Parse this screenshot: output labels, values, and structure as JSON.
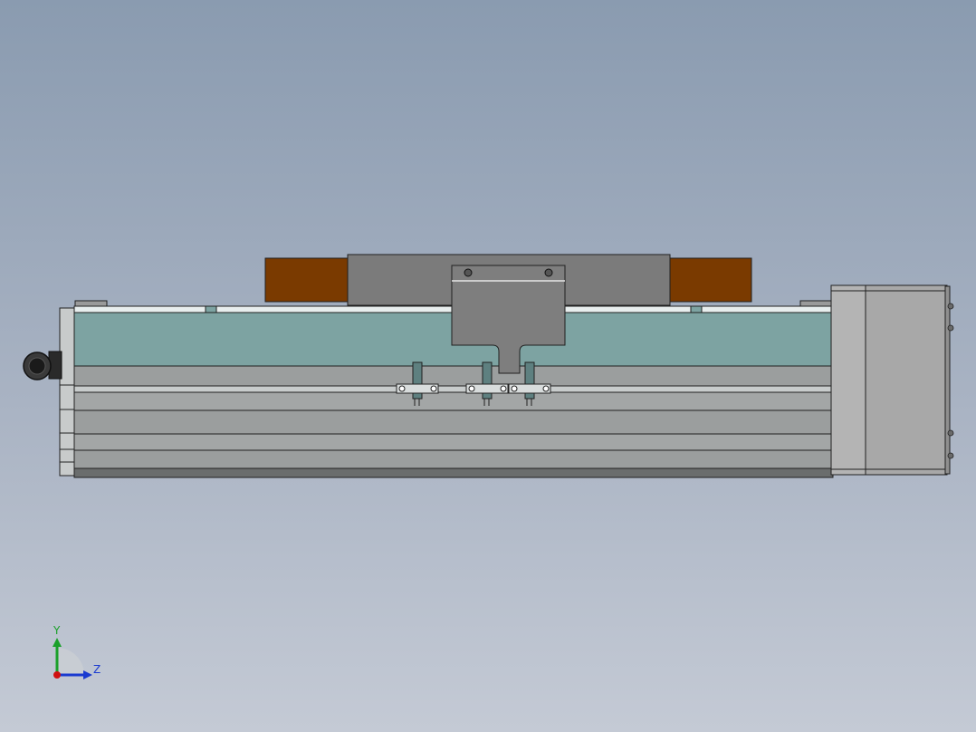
{
  "viewport": {
    "background_top": "#8a9bb0",
    "background_bottom": "#c4cad5"
  },
  "colors": {
    "rail_teal": "#7da3a2",
    "carriage_gray": "#7b7b7b",
    "bellows_brown": "#7a3a00",
    "motor_gray": "#a8a8a8",
    "outline": "#202020"
  },
  "triad": {
    "y_label": "Y",
    "z_label": "Z",
    "y_color": "#1aa02a",
    "z_color": "#1a3ad0",
    "origin_color": "#d01010"
  }
}
